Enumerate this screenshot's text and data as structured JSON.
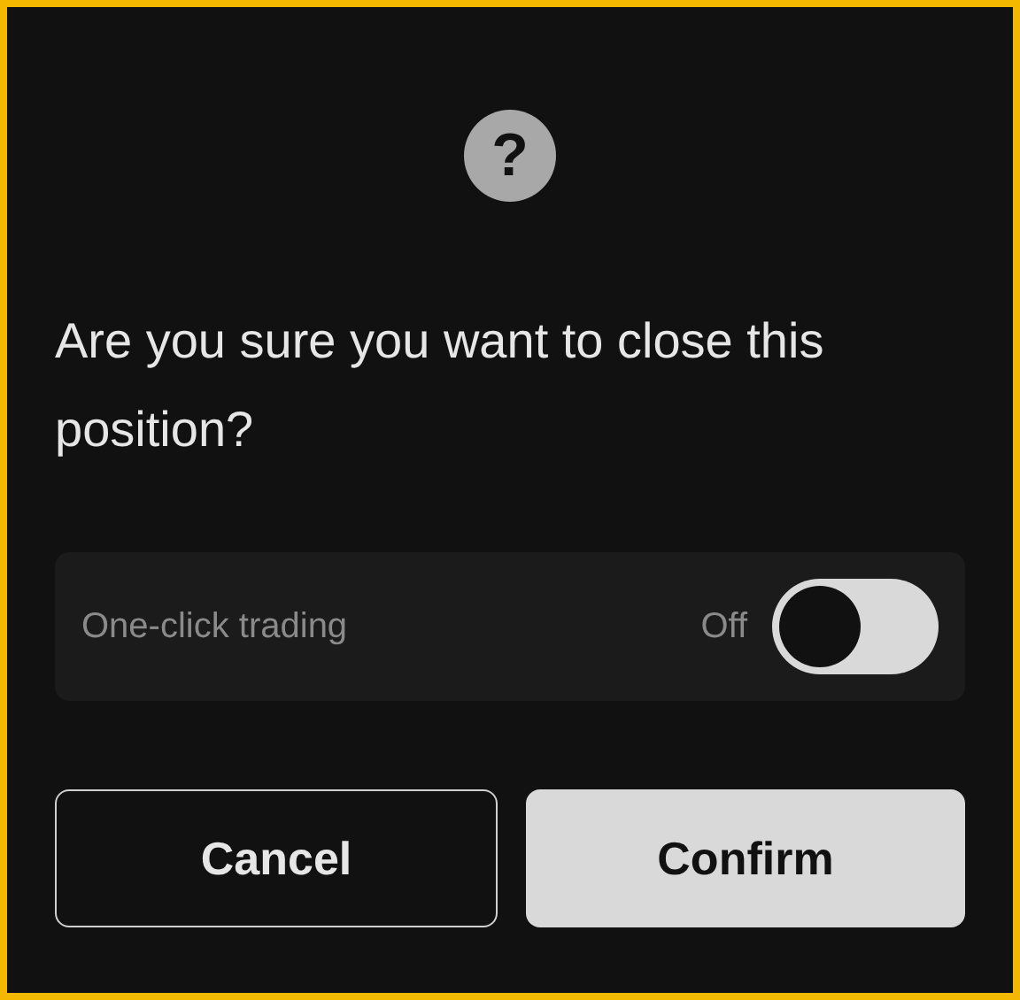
{
  "dialog": {
    "icon": "?",
    "message": "Are you sure you want to close this position?",
    "setting": {
      "label": "One-click trading",
      "state_text": "Off",
      "on": false
    },
    "buttons": [
      {
        "label": "Cancel",
        "kind": "secondary"
      },
      {
        "label": "Confirm",
        "kind": "primary"
      }
    ]
  }
}
